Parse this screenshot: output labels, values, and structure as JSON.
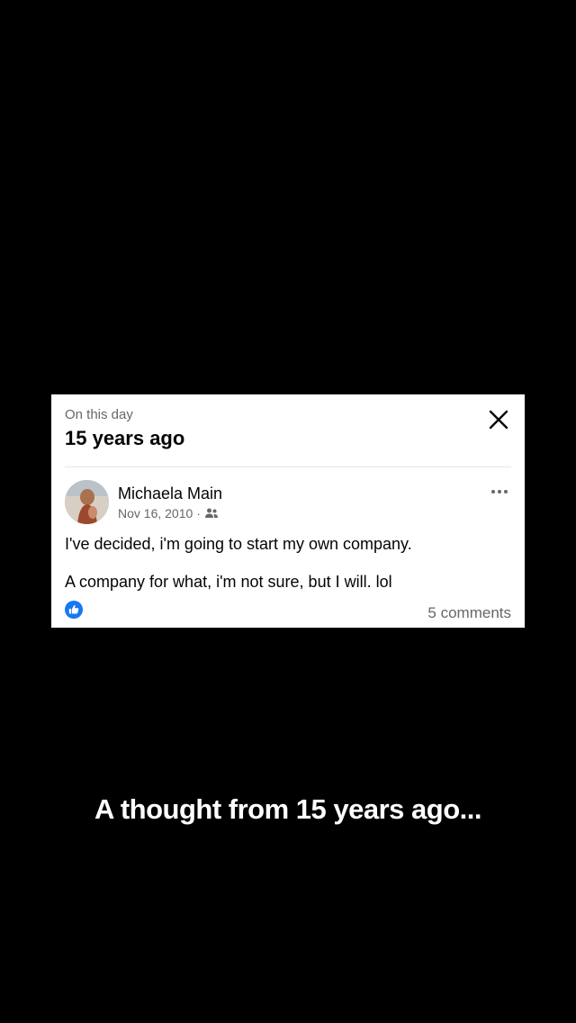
{
  "memory": {
    "label": "On this day",
    "title": "15 years ago"
  },
  "post": {
    "author": "Michaela Main",
    "date": "Nov 16, 2010",
    "separator": "·",
    "audience_icon": "friends-icon",
    "lines": [
      "I've decided, i'm going to start my own company.",
      "A company for what, i'm not sure, but I will. lol"
    ],
    "reaction_icon": "like-icon",
    "comments": "5 comments"
  },
  "caption": "A thought from 15 years ago...",
  "colors": {
    "background": "#000000",
    "card": "#ffffff",
    "like_blue": "#1877f2",
    "secondary_text": "#65676b"
  }
}
